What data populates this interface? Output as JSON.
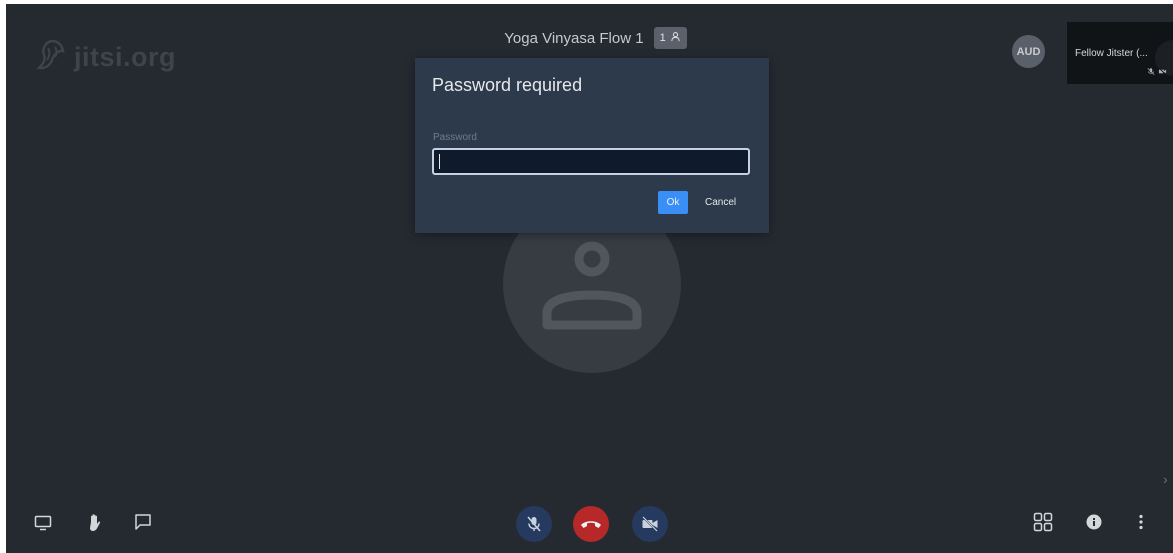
{
  "watermark": {
    "text": "jitsi.org",
    "icon": "jitsi-logo-icon"
  },
  "header": {
    "conference_name": "Yoga Vinyasa Flow 1",
    "participant_count": "1",
    "participants_icon": "participants-icon"
  },
  "local_avatar": {
    "initials": "AUD"
  },
  "remote_thumbnail": {
    "name": "Fellow Jitster (...",
    "status_icons": [
      "mic-muted-icon",
      "video-off-icon"
    ]
  },
  "dialog": {
    "title": "Password required",
    "field_label": "Password",
    "input_value": "",
    "input_placeholder": "",
    "ok_label": "Ok",
    "cancel_label": "Cancel"
  },
  "toolbar": {
    "left": [
      "screenshare-icon",
      "raise-hand-icon",
      "chat-icon"
    ],
    "center": [
      "mic-muted-icon",
      "hangup-icon",
      "video-off-icon"
    ],
    "right": [
      "tile-view-icon",
      "info-icon",
      "more-options-icon"
    ]
  },
  "colors": {
    "background": "#252a31",
    "dialog": "#2c3a4c",
    "ok": "#3a8ff7",
    "hangup": "#b72828",
    "mic_camera": "#253a5e"
  }
}
